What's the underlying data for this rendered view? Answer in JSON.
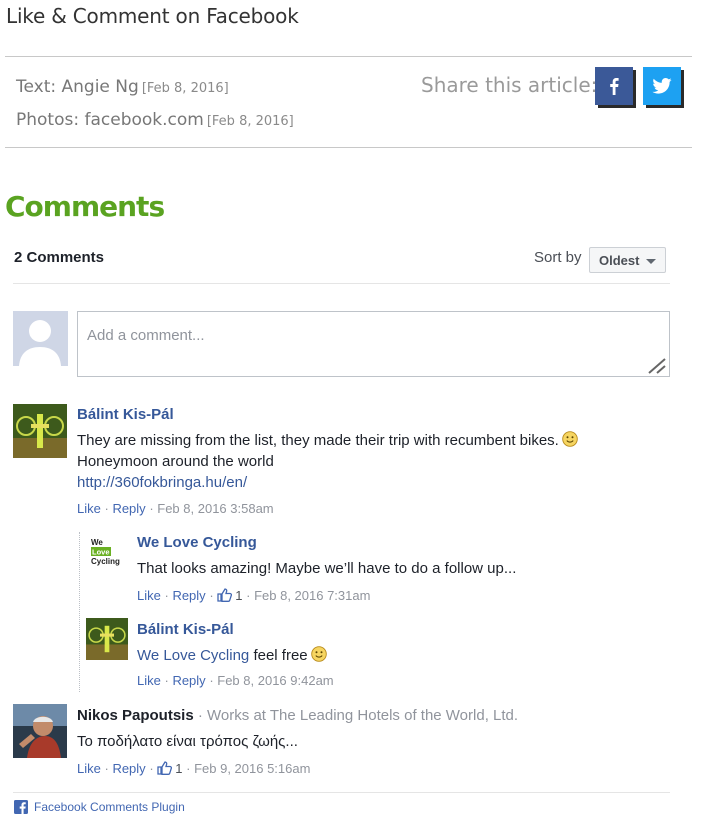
{
  "article": {
    "heading": "Like & Comment on Facebook",
    "text_credit": "Text: Angie Ng",
    "text_date": "[Feb 8, 2016]",
    "photo_credit": "Photos: facebook.com",
    "photo_date": "[Feb 8, 2016]",
    "share_label": "Share this article:"
  },
  "icons": {
    "share_facebook": "facebook-icon",
    "share_twitter": "twitter-icon",
    "plugin": "facebook-square-icon",
    "like_count": "thumbs-up-icon",
    "emoji": "smiley-icon"
  },
  "colors": {
    "comments_heading": "#5aa321",
    "link": "#365899",
    "facebook": "#3b5998",
    "twitter": "#1da1f2"
  },
  "comments": {
    "heading": "Comments",
    "count_label": "2 Comments",
    "sort_label": "Sort by",
    "sort_value": "Oldest",
    "input_placeholder": "Add a comment...",
    "items": [
      {
        "author": "Bálint Kis-Pál",
        "line1": "They are missing from the list, they made their trip with recumbent bikes.",
        "line2": "Honeymoon around the world",
        "link": "http://360fokbringa.hu/en/",
        "like": "Like",
        "reply": "Reply",
        "time": "Feb 8, 2016 3:58am",
        "replies": [
          {
            "author": "We Love Cycling",
            "avatar_text": [
              "We",
              "Love",
              "Cycling"
            ],
            "text": "That looks amazing! Maybe we’ll have to do a follow up...",
            "like": "Like",
            "reply": "Reply",
            "likes": "1",
            "time": "Feb 8, 2016 7:31am"
          },
          {
            "author": "Bálint Kis-Pál",
            "mention": "We Love Cycling",
            "text": "feel free",
            "like": "Like",
            "reply": "Reply",
            "time": "Feb 8, 2016 9:42am"
          }
        ]
      },
      {
        "author": "Nikos Papoutsis",
        "work": "Works at The Leading Hotels of the World, Ltd.",
        "text": "Το ποδήλατο είναι τρόπος ζωής...",
        "like": "Like",
        "reply": "Reply",
        "likes": "1",
        "time": "Feb 9, 2016 5:16am"
      }
    ]
  },
  "plugin_label": "Facebook Comments Plugin"
}
